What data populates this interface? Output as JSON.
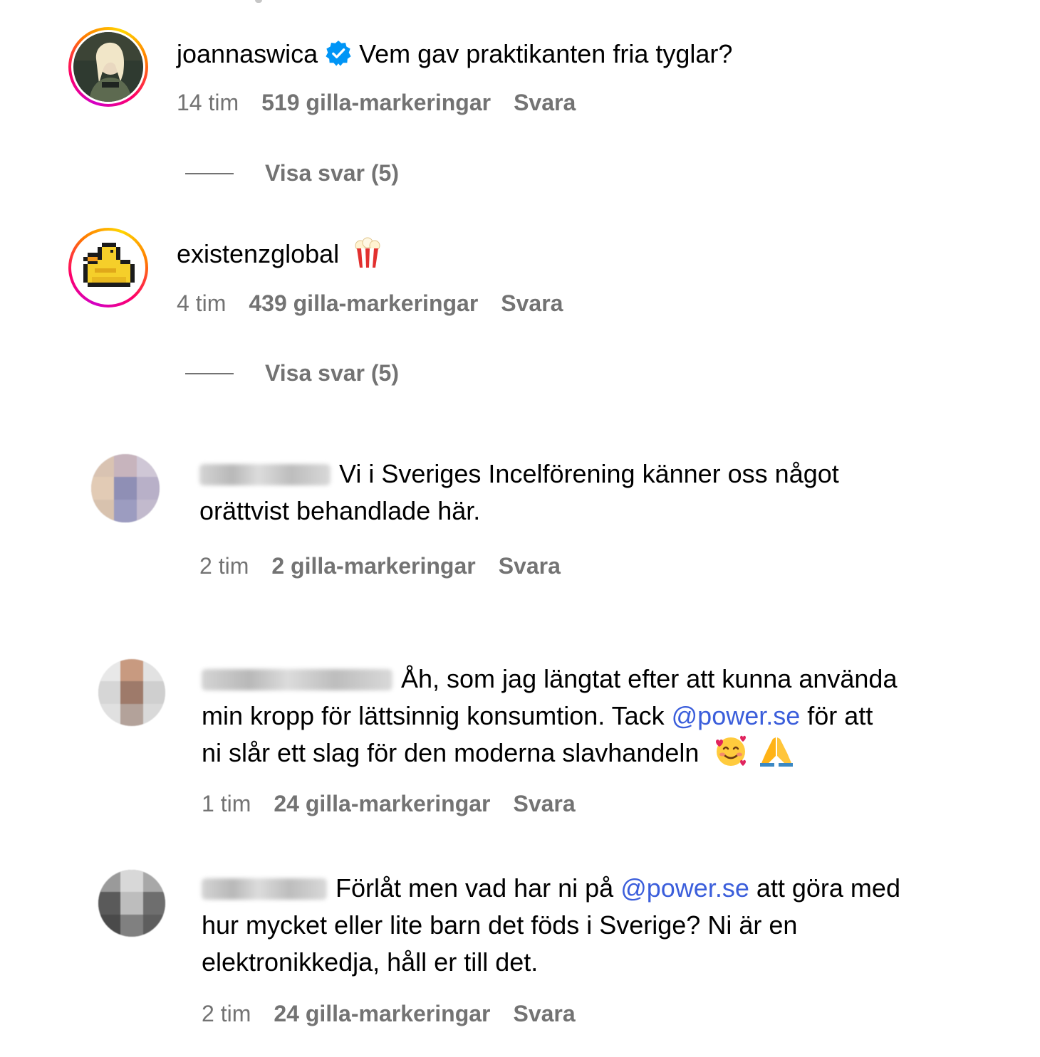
{
  "comments": [
    {
      "username": "joannaswica",
      "verified": true,
      "text": "Vem gav praktikanten fria tyglar?",
      "time": "14 tim",
      "likes": "519 gilla-markeringar",
      "reply_label": "Svara",
      "view_replies": "Visa svar (5)"
    },
    {
      "username": "existenzglobal",
      "emoji": "popcorn-icon",
      "time": "4 tim",
      "likes": "439 gilla-markeringar",
      "reply_label": "Svara",
      "view_replies": "Visa svar (5)"
    },
    {
      "text_line1": "Vi i Sveriges Incelförening känner oss något",
      "text_line2": "orättvist behandlade här.",
      "time": "2 tim",
      "likes": "2 gilla-markeringar",
      "reply_label": "Svara"
    },
    {
      "text_line1": "Åh, som jag längtat efter att kunna använda",
      "text_line2_a": "min kropp för lättsinnig konsumtion. Tack ",
      "mention": "@power.se",
      "text_line2_b": " för att",
      "text_line3": "ni slår ett slag för den moderna slavhandeln",
      "emojis": [
        "smiling-face-with-hearts-icon",
        "folded-hands-icon"
      ],
      "time": "1 tim",
      "likes": "24 gilla-markeringar",
      "reply_label": "Svara"
    },
    {
      "text_line1_a": "Förlåt men vad har ni på ",
      "mention": "@power.se",
      "text_line1_b": " att göra med",
      "text_line2": "hur mycket eller lite barn det föds i Sverige? Ni är en",
      "text_line3": "elektronikkedja, håll er till det.",
      "time": "2 tim",
      "likes": "24 gilla-markeringar",
      "reply_label": "Svara"
    }
  ],
  "colors": {
    "text": "#000000",
    "meta": "#737373",
    "mention": "#3b5edb",
    "verified": "#0095f6"
  }
}
